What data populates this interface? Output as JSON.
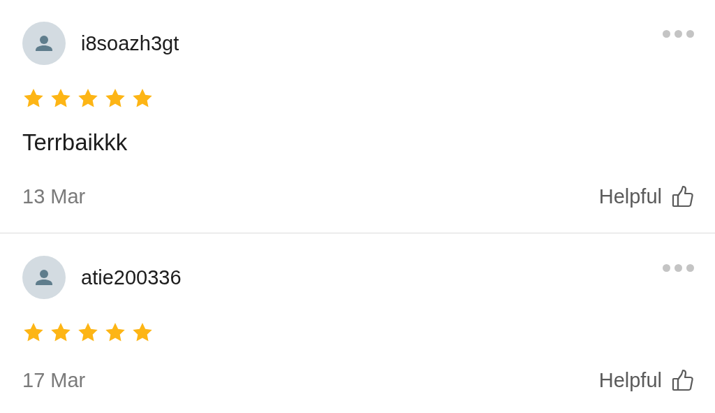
{
  "reviews": [
    {
      "username": "i8soazh3gt",
      "stars": 5,
      "text": "Terrbaikkk",
      "date": "13 Mar",
      "helpful_label": "Helpful"
    },
    {
      "username": "atie200336",
      "stars": 5,
      "date": "17 Mar",
      "helpful_label": "Helpful"
    }
  ]
}
